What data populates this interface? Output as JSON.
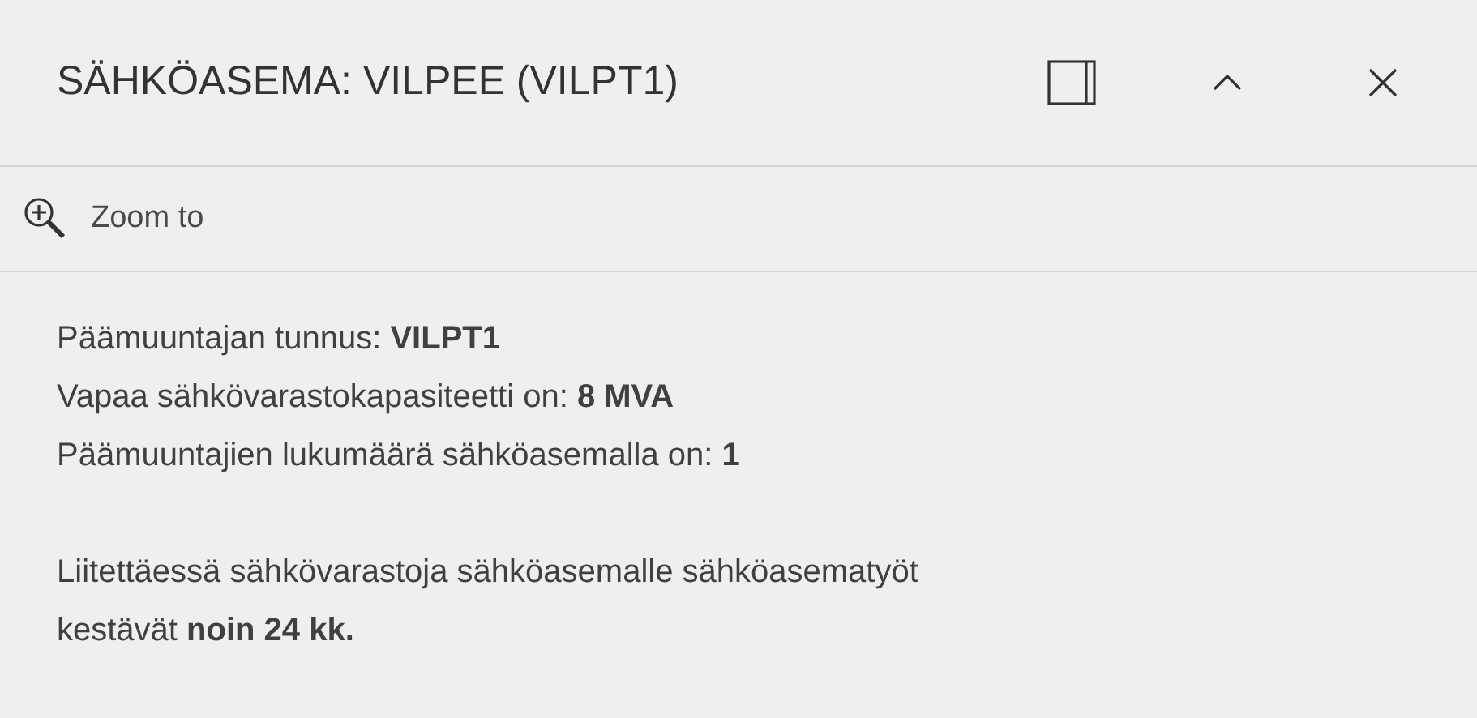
{
  "header": {
    "title": "SÄHKÖASEMA: VILPEE (VILPT1)"
  },
  "actions": [
    {
      "label": "Zoom to"
    }
  ],
  "attributes": [
    {
      "text": "Päämuuntajan tunnus: **VILPT1**"
    },
    {
      "text": "Vapaa sähkövarastokapasiteetti on: **8 MVA**"
    },
    {
      "text": "Päämuuntajien lukumäärä sähköasemalla on: **1**"
    }
  ],
  "note": "Liitettäessä sähkövarastoja sähköasemalle sähköasematyöt kestävät **noin 24 kk.**"
}
